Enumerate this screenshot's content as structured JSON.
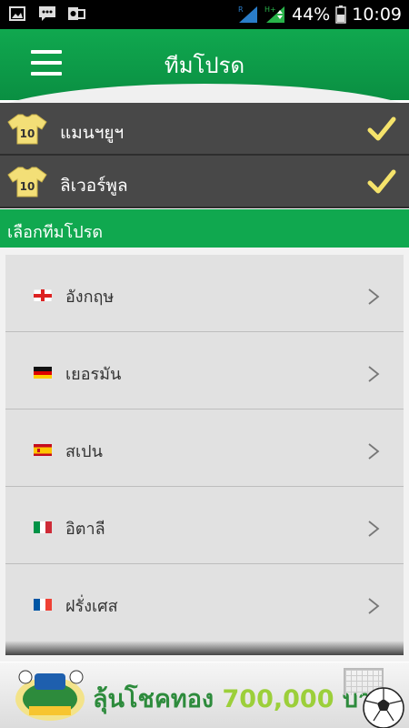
{
  "status_bar": {
    "battery_percent": "44%",
    "time": "10:09",
    "icons": [
      "image-icon",
      "message-icon",
      "outlook-icon",
      "signal-r-icon",
      "signal-hplus-icon",
      "battery-icon"
    ]
  },
  "header": {
    "title": "ทีมโปรด",
    "menu_icon": "hamburger-menu-icon"
  },
  "favorites": [
    {
      "name": "แมนฯยูฯ",
      "icon": "jersey-10-icon",
      "checked": true
    },
    {
      "name": "ลิเวอร์พูล",
      "icon": "jersey-10-icon",
      "checked": true
    }
  ],
  "section_title": "เลือกทีมโปรด",
  "countries": [
    {
      "name": "อังกฤษ",
      "flag": "england-flag-icon"
    },
    {
      "name": "เยอรมัน",
      "flag": "germany-flag-icon"
    },
    {
      "name": "สเปน",
      "flag": "spain-flag-icon"
    },
    {
      "name": "อิตาลี",
      "flag": "italy-flag-icon"
    },
    {
      "name": "ฝรั่งเศส",
      "flag": "france-flag-icon"
    }
  ],
  "banner": {
    "text_a": "ลุ้นโชคทอง",
    "text_b": "700,000",
    "text_c": "บาท",
    "logo": "cheer-logo-icon"
  },
  "colors": {
    "primary_green": "#10a84f",
    "row_dark": "#484848",
    "check_yellow": "#f5e36b",
    "jersey_yellow": "#f3df77"
  }
}
